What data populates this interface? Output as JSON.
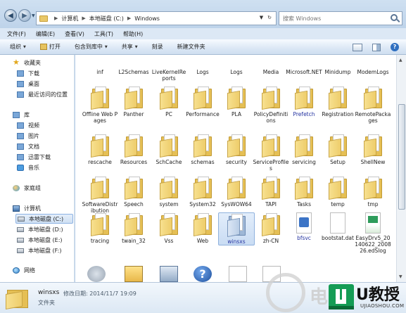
{
  "address": {
    "breadcrumbs": [
      "计算机",
      "本地磁盘 (C:)",
      "Windows"
    ],
    "search_placeholder": "搜索 Windows"
  },
  "menu": [
    "文件(F)",
    "编辑(E)",
    "查看(V)",
    "工具(T)",
    "帮助(H)"
  ],
  "commands": {
    "organize": "组织",
    "open": "打开",
    "include_in_library": "包含到库中",
    "share": "共享",
    "burn": "刻录",
    "new_folder": "新建文件夹"
  },
  "nav": {
    "favorites": "收藏夹",
    "downloads": "下载",
    "desktop": "桌面",
    "recent": "最近访问的位置",
    "libraries": "库",
    "videos": "视频",
    "pictures": "图片",
    "documents": "文档",
    "xunlei": "迅雷下载",
    "music": "音乐",
    "homegroup": "家庭组",
    "computer": "计算机",
    "drive_c": "本地磁盘 (C:)",
    "drive_d": "本地磁盘 (D:)",
    "drive_e": "本地磁盘 (E:)",
    "drive_f": "本地磁盘 (F:)",
    "network": "网络"
  },
  "files": {
    "row1": [
      "inf",
      "L2Schemas",
      "LiveKernelReports",
      "Logs",
      "Logs",
      "Media",
      "Microsoft.NET",
      "Minidump",
      "ModemLogs"
    ],
    "row2": [
      "Offline Web Pages",
      "Panther",
      "PC",
      "Performance",
      "PLA",
      "PolicyDefinitions",
      "Prefetch",
      "Registration",
      "RemotePackages"
    ],
    "row3": [
      "rescache",
      "Resources",
      "SchCache",
      "schemas",
      "security",
      "ServiceProfiles",
      "servicing",
      "Setup",
      "ShellNew"
    ],
    "row4": [
      "SoftwareDistribution",
      "Speech",
      "system",
      "System32",
      "SysWOW64",
      "TAPI",
      "Tasks",
      "temp",
      "tmp"
    ],
    "row5": [
      "tracing",
      "twain_32",
      "Vss",
      "Web",
      "winsxs",
      "zh-CN",
      "bfsvc",
      "bootstat.dat",
      "EasyDrv5_20140622_200826.edSlog"
    ]
  },
  "details": {
    "name": "winsxs",
    "modified": "修改日期: 2014/11/7 19:09",
    "type": "文件夹"
  },
  "watermark": {
    "chars": "电脑",
    "brand": "U教授",
    "domain": "UJIAOSHOU.COM"
  }
}
